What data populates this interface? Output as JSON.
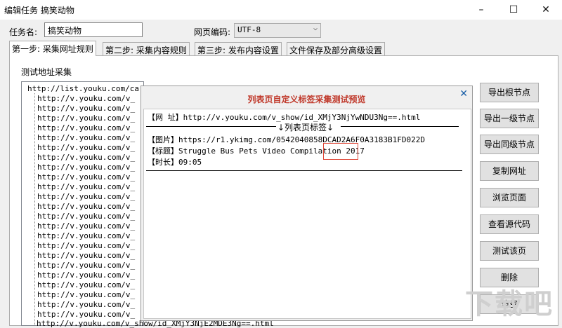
{
  "window": {
    "title": "编辑任务 搞笑动物",
    "minimize": "–",
    "maximize": "☐",
    "close": "✕"
  },
  "form": {
    "task_name_label": "任务名:",
    "task_name_value": "搞笑动物",
    "encoding_label": "网页编码:",
    "encoding_value": "UTF-8"
  },
  "tabs": [
    "第一步: 采集网址规则",
    "第二步: 采集内容规则",
    "第三步: 发布内容设置",
    "文件保存及部分高级设置"
  ],
  "group_label": "测试地址采集",
  "tree": {
    "root": "http://list.youku.com/ca",
    "child": "http://v.youku.com/v_",
    "last_child": "http://v.youku.com/v_show/id_XMjY3NjE2MDE3Ng==.html"
  },
  "side_buttons": [
    "导出根节点",
    "导出一级节点",
    "导出同级节点",
    "复制网址",
    "浏览页面",
    "查看源代码",
    "测试该页",
    "删除",
    "清空"
  ],
  "dialog": {
    "title": "列表页自定义标签采集测试预览",
    "close": "✕",
    "url_label": "【网  址】",
    "url_value": "http://v.youku.com/v_show/id_XMjY3NjYwNDU3Ng==.html",
    "list_tag": "↓列表页标签↓",
    "image_label": "【图片】",
    "image_value": "https://r1.ykimg.com/0542040858DCAD2A6F0A3183B1FD022D",
    "caption_label": "【标题】",
    "caption_value": "Struggle Bus Pets Video Compilation 2017",
    "duration_label": "【时长】",
    "duration_value": "09:05"
  },
  "watermark": "下载吧"
}
